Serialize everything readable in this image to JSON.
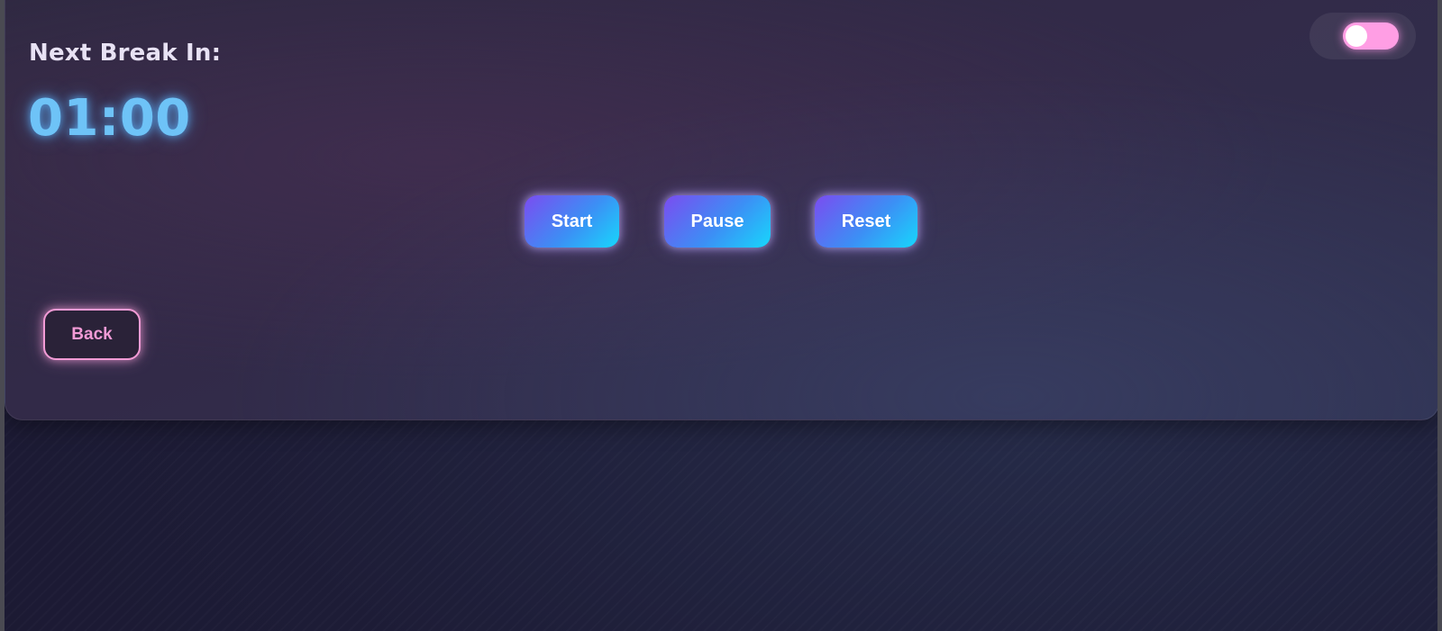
{
  "timer_panel": {
    "title": "Next Break In:",
    "time_display": "01:00"
  },
  "controls": {
    "start_label": "Start",
    "pause_label": "Pause",
    "reset_label": "Reset"
  },
  "navigation": {
    "back_label": "Back"
  },
  "theme_toggle": {
    "state": "on",
    "color": "#ff9ee4"
  },
  "colors": {
    "accent_gradient_start": "#7b4cf0",
    "accent_gradient_end": "#17d7fc",
    "timer_color": "#6ec3f7",
    "back_accent": "#f29bd6"
  }
}
